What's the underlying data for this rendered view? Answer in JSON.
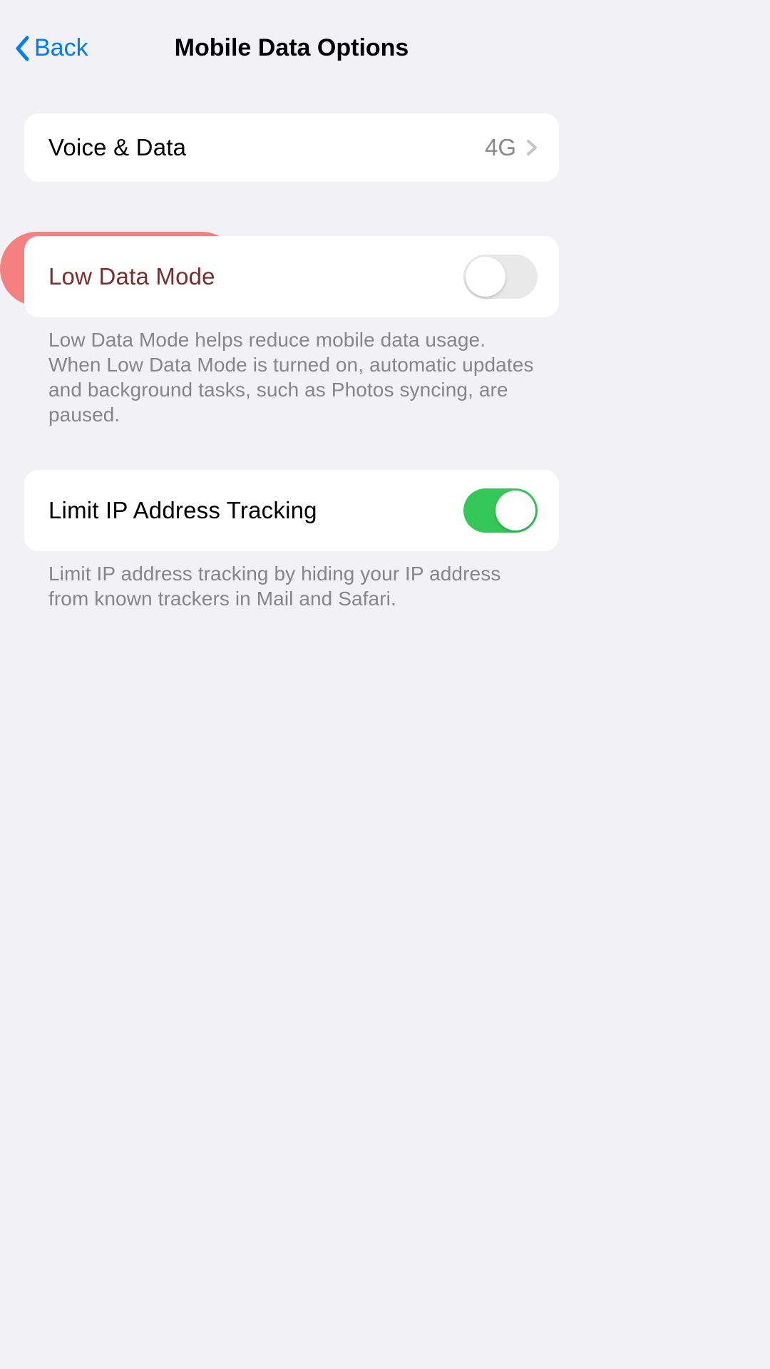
{
  "header": {
    "back_label": "Back",
    "title": "Mobile Data Options"
  },
  "sections": {
    "voice_data": {
      "label": "Voice & Data",
      "value": "4G"
    },
    "low_data": {
      "label": "Low Data Mode",
      "footer": "Low Data Mode helps reduce mobile data usage. When Low Data Mode is turned on, automatic updates and background tasks, such as Photos syncing, are paused.",
      "enabled": false
    },
    "limit_ip": {
      "label": "Limit IP Address Tracking",
      "footer": "Limit IP address tracking by hiding your IP address from known trackers in Mail and Safari.",
      "enabled": true
    }
  }
}
